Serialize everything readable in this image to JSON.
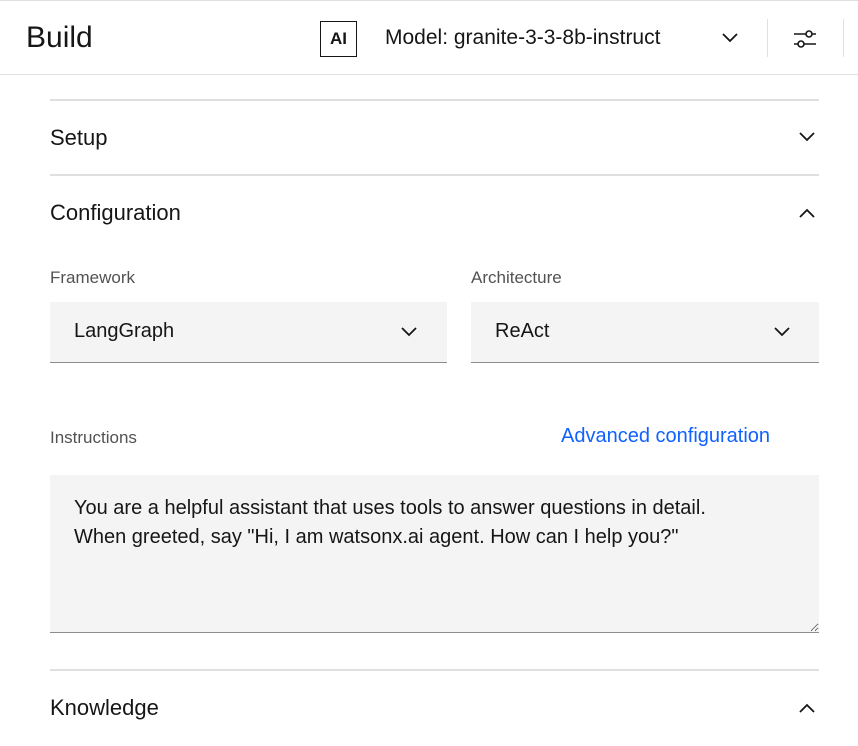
{
  "header": {
    "title": "Build",
    "ai_badge": "AI",
    "model_label": "Model: granite-3-3-8b-instruct"
  },
  "sections": {
    "setup": "Setup",
    "configuration": "Configuration",
    "knowledge": "Knowledge"
  },
  "config": {
    "framework_label": "Framework",
    "framework_value": "LangGraph",
    "architecture_label": "Architecture",
    "architecture_value": "ReAct",
    "instructions_label": "Instructions",
    "advanced_link": "Advanced configuration",
    "instructions_value": "You are a helpful assistant that uses tools to answer questions in detail.\nWhen greeted, say \"Hi, I am watsonx.ai agent. How can I help you?\""
  },
  "colors": {
    "link": "#0f62fe",
    "field_bg": "#f4f4f4"
  }
}
